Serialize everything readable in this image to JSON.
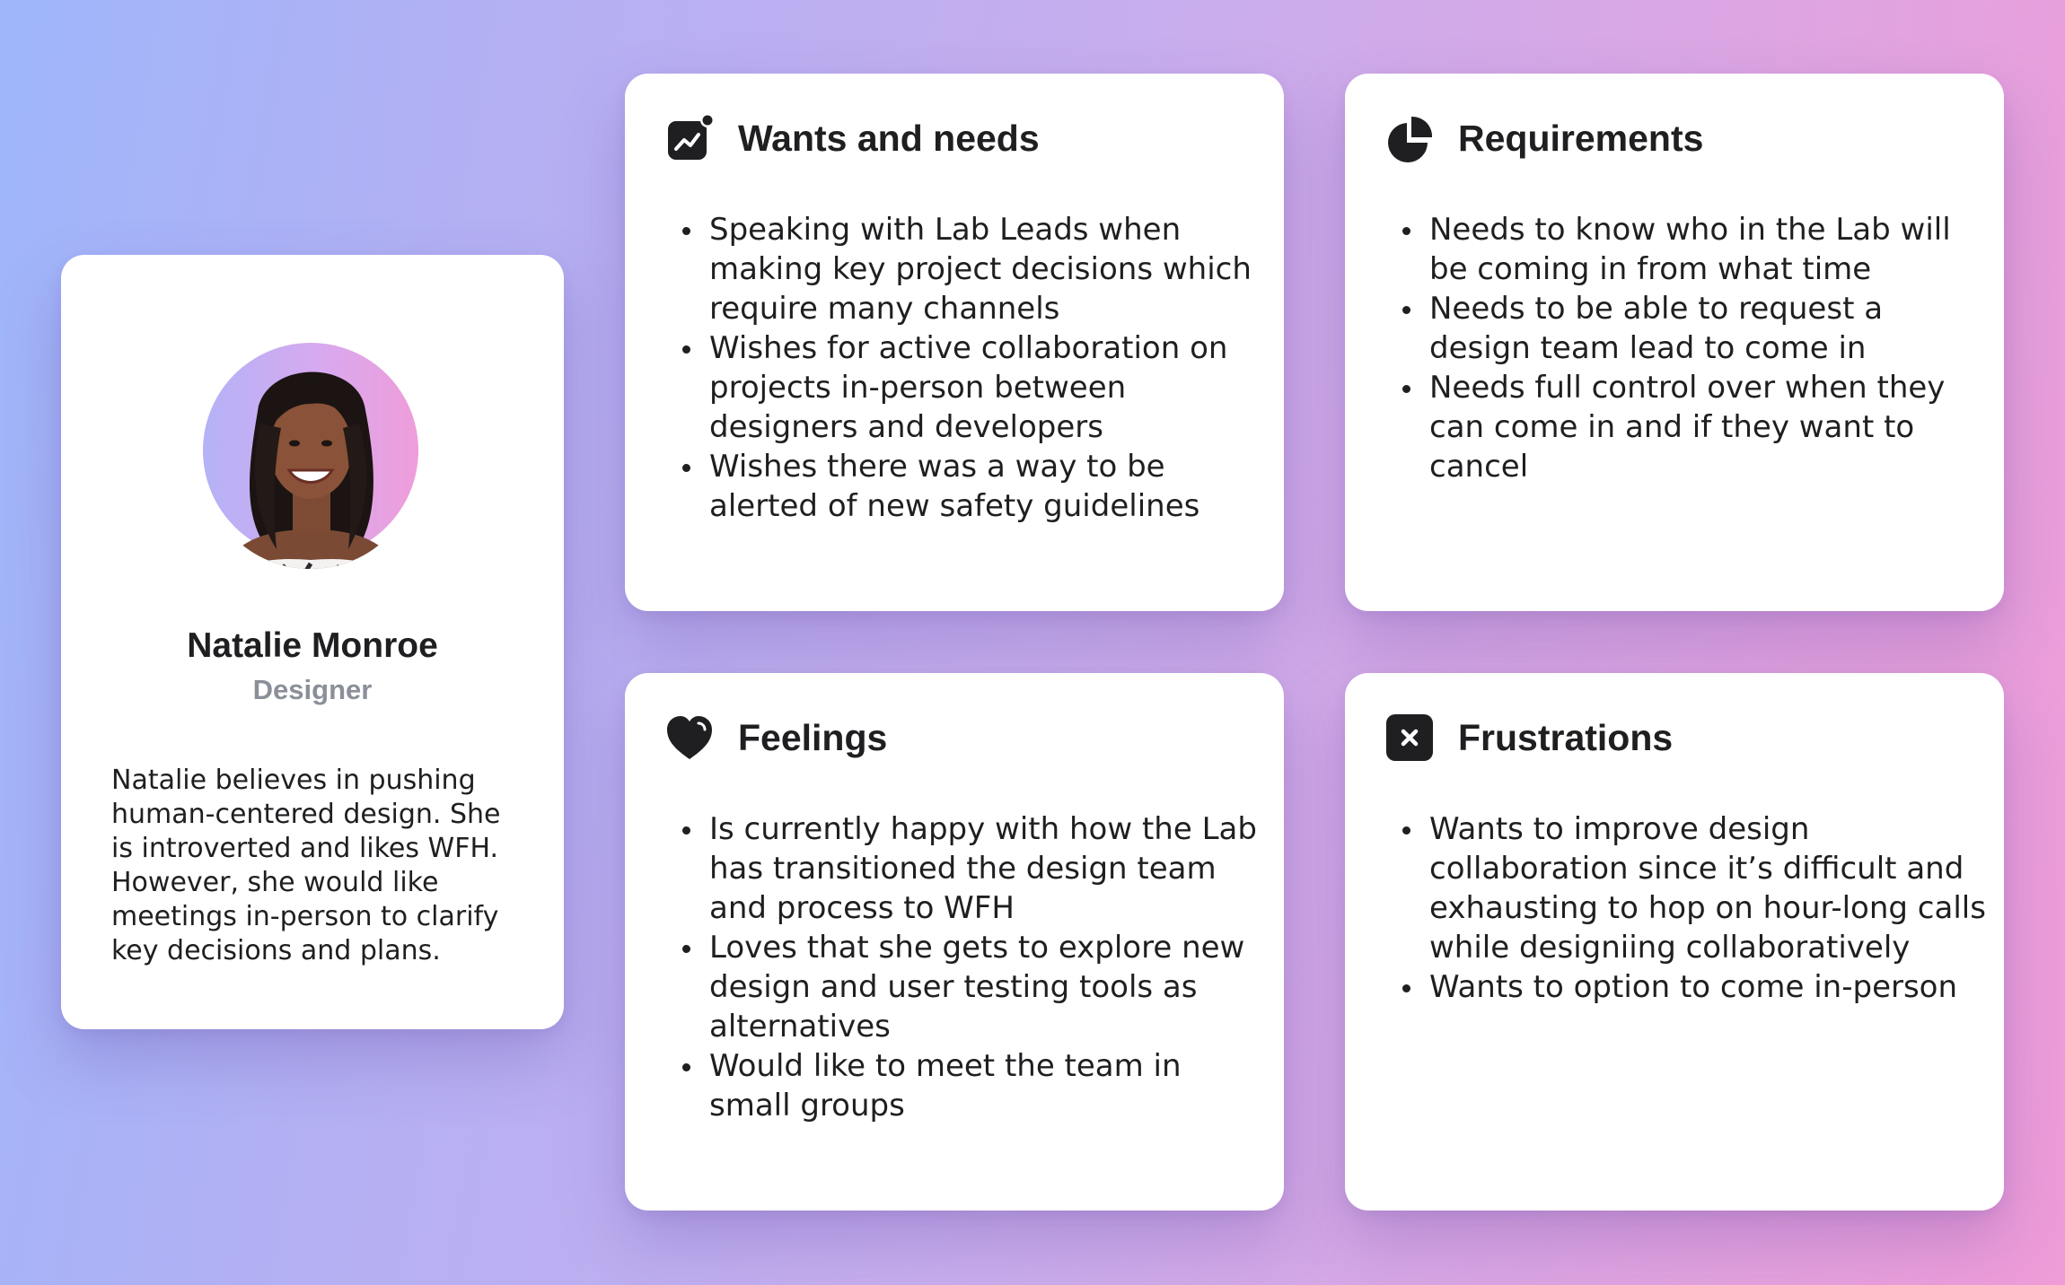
{
  "profile": {
    "name": "Natalie Monroe",
    "role": "Designer",
    "bio": "Natalie believes in pushing human-centered design. She is introverted and likes WFH. However, she would like meetings in-person to clarify key decisions and plans."
  },
  "cards": {
    "wants": {
      "title": "Wants and needs",
      "icon": "trend-chart-icon",
      "items": [
        "Speaking with Lab Leads when making key project decisions which require many channels",
        "Wishes for active collaboration on projects in-person between designers and developers",
        "Wishes there was a way to be alerted of new safety guidelines"
      ]
    },
    "requirements": {
      "title": "Requirements",
      "icon": "pie-chart-icon",
      "items": [
        "Needs to know who in the Lab will be coming in from what time",
        "Needs to be able to request a design team lead to come in",
        "Needs full control over when they can come in and if they want to cancel"
      ]
    },
    "feelings": {
      "title": "Feelings",
      "icon": "heart-icon",
      "items": [
        "Is currently happy with how the Lab has transitioned the design team and process to WFH",
        "Loves that she gets to explore new design and user testing tools as alternatives",
        "Would like to meet the team in small groups"
      ]
    },
    "frustrations": {
      "title": "Frustrations",
      "icon": "close-square-icon",
      "items": [
        "Wants to improve design collaboration since it’s difficult and exhausting to hop on hour-long calls while designiing collaboratively",
        "Wants to option to come in-person"
      ]
    }
  },
  "colors": {
    "background_start": "#9fb6fb",
    "background_end": "#ef9cd8",
    "card": "#ffffff",
    "text": "#1f1f22",
    "muted": "#8a8f99"
  }
}
